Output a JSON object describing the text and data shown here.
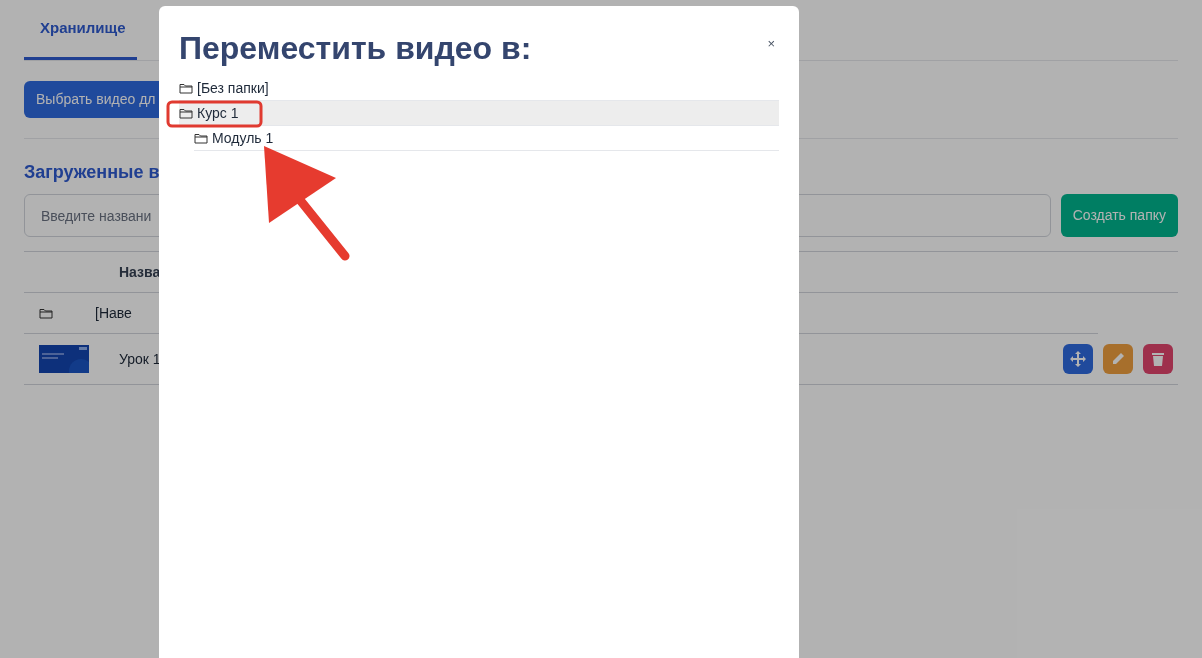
{
  "page": {
    "tabs": [
      {
        "label": "Хранилище",
        "selected": true
      }
    ],
    "upload_button": "Выбрать видео дл",
    "section_title": "Загруженные в",
    "folder_input": {
      "placeholder": "Введите названи"
    },
    "create_folder_button": "Создать папку",
    "table": {
      "header": "Назва",
      "rows": [
        {
          "kind": "folder",
          "name": "[Наве"
        },
        {
          "kind": "video",
          "name": "Урок 1"
        }
      ]
    }
  },
  "modal": {
    "title": "Переместить видео в:",
    "close": "×",
    "tree": [
      {
        "label": "[Без папки]",
        "selected": false
      },
      {
        "label": "Курс 1",
        "selected": true,
        "children": [
          {
            "label": "Модуль 1",
            "selected": false
          }
        ]
      }
    ]
  }
}
